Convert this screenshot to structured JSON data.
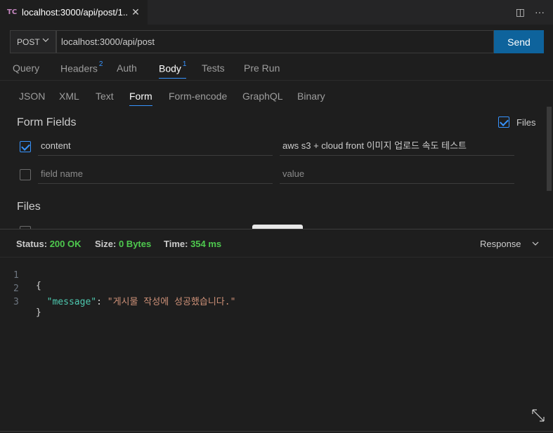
{
  "tab": {
    "icon": "TC",
    "title": "localhost:3000/api/post/1..",
    "close_icon": "✕",
    "split_icon": "◫",
    "more_icon": "···"
  },
  "request": {
    "method": "POST",
    "url": "localhost:3000/api/post",
    "send_label": "Send"
  },
  "request_tabs": [
    {
      "label": "Query",
      "badge": ""
    },
    {
      "label": "Headers",
      "badge": "2"
    },
    {
      "label": "Auth",
      "badge": ""
    },
    {
      "label": "Body",
      "badge": "1"
    },
    {
      "label": "Tests",
      "badge": ""
    },
    {
      "label": "Pre Run",
      "badge": ""
    }
  ],
  "body_tabs": [
    "JSON",
    "XML",
    "Text",
    "Form",
    "Form-encode",
    "GraphQL",
    "Binary"
  ],
  "form": {
    "title": "Form Fields",
    "files_label": "Files",
    "rows": [
      {
        "name": "content",
        "value": "aws s3 + cloud front 이미지 업로드 속도 테스트"
      },
      {
        "name_placeholder": "field name",
        "value_placeholder": "value"
      }
    ],
    "files_heading": "Files"
  },
  "status": {
    "status_label": "Status:",
    "status_value": "200 OK",
    "size_label": "Size:",
    "size_value": "0 Bytes",
    "time_label": "Time:",
    "time_value": "354 ms",
    "response_label": "Response"
  },
  "response_body": {
    "line1": "{",
    "key": "\"message\"",
    "colon": ": ",
    "value": "\"게시물 작성에 성공했습니다.\"",
    "line3": "}"
  },
  "colors": {
    "accent": "#3794ff",
    "send_button": "#0e639c",
    "ok_green": "#4ec94e"
  }
}
